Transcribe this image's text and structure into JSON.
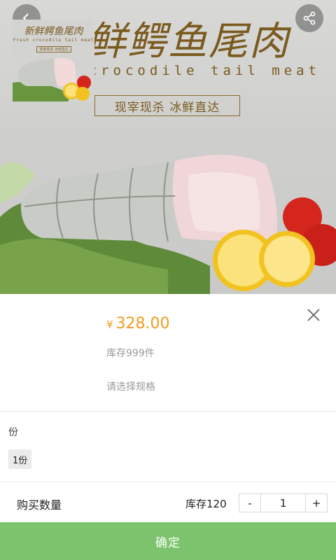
{
  "banner": {
    "title": "新鲜鳄鱼尾肉",
    "subtitle": "Fresh crocodile tail meat",
    "slogan": "现宰现杀  冰鲜直达"
  },
  "thumbnail": {
    "title": "新鲜鳄鱼尾肉",
    "subtitle": "Fresh crocodile tail meat",
    "slogan": "现宰现杀  冰鲜直达"
  },
  "product": {
    "currency": "¥",
    "price": "328.00",
    "stock": "库存999件",
    "choose_hint": "请选择规格"
  },
  "spec": {
    "label": "份",
    "options": [
      "1份"
    ]
  },
  "quantity": {
    "label": "购买数量",
    "stock": "库存120",
    "minus": "-",
    "value": "1",
    "plus": "+"
  },
  "confirm_label": "确定",
  "colors": {
    "accent_price": "#f39a1e",
    "confirm_bg": "#7bc46d",
    "banner_text": "#7a5a1e"
  },
  "icons": [
    "back-icon",
    "share-icon",
    "close-icon"
  ]
}
